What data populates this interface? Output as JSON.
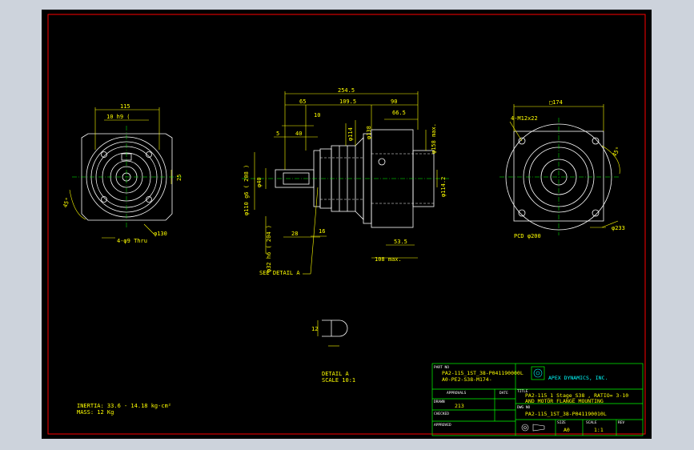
{
  "colors": {
    "background": "#000000",
    "frame": "#ff0000",
    "geometry": "#ffffff",
    "dimension": "#ffff00",
    "accent": "#00ff00",
    "chrome": "#cdd3dc"
  },
  "dims": {
    "left_115": "115",
    "left_h9": "10 h9 (",
    "left_130": "φ130",
    "left_holes": "4-φ9 Thru",
    "left_25": "25",
    "left_45": "45°",
    "top_2545": "254.5",
    "top_65": "65",
    "top_1095": "109.5",
    "top_90": "90",
    "top_10": "10",
    "top_5": "5",
    "top_40": "40",
    "top_665": "66.5",
    "d_114": "φ114",
    "d_138": "φ138",
    "d_158": "φ158 max.",
    "d_1142": "φ114.2",
    "left_fi1": "φ110 g6 ( 208 )",
    "left_fi2": "φ40",
    "left_fi3": "φ32 h6 ( 204 )",
    "bot_28": "28",
    "bot_16": "16",
    "bot_535": "53.5",
    "bot_108": "108 max.",
    "see_detail": "SEE DETAIL A",
    "r_174": "□174",
    "r_m12": "4-M12x22",
    "r_45": "45°",
    "r_233": "φ233",
    "r_pcd": "PCD φ200",
    "detail_12": "12",
    "detail_title": "DETAIL A",
    "detail_scale": "SCALE 10:1"
  },
  "notes": {
    "inertia": "INERTIA: 33.6 - 14.18 kg-cm²",
    "mass": "MASS: 12   Kg"
  },
  "title_block": {
    "part_no_label": "PART NO",
    "part_no_1": "PA2-115_1ST_38-P041190000L",
    "part_no_2": "A0-PE2-S38-M174-",
    "company": "APEX DYNAMICS, INC.",
    "approvals_label": "APPROVALS",
    "date_label": "DATE",
    "drawn_label": "DRAWN",
    "drawn_value": "213",
    "checked_label": "CHECKED",
    "approved_label": "APPROVED",
    "title_label": "TITLE",
    "title_1": "PA2-115_1 Stage_S38 , RATIO= 3-10",
    "title_2": "AND MOTOR FLANGE MOUNTING",
    "dwg_label": "DWG NO",
    "dwg_no": "PA2-115_1ST_38-P041190010L",
    "size_label": "SIZE",
    "size_value": "A0",
    "scale_label": "SCALE",
    "scale_value": "1:1",
    "rev_label": "REV"
  }
}
